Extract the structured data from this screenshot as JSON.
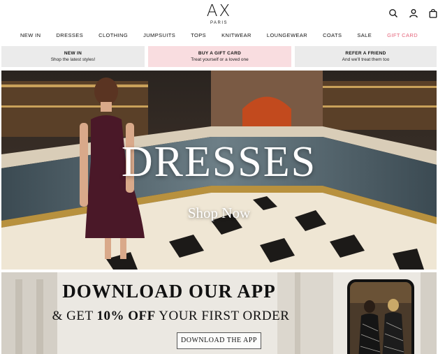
{
  "brand": {
    "name": "AX",
    "subtitle": "PARIS"
  },
  "header_icons": [
    "search-icon",
    "account-icon",
    "bag-icon"
  ],
  "nav": {
    "items": [
      "NEW IN",
      "DRESSES",
      "CLOTHING",
      "JUMPSUITS",
      "TOPS",
      "KNITWEAR",
      "LOUNGEWEAR",
      "COATS",
      "SALE"
    ],
    "gift": "GIFT CARD",
    "gift_color": "#e5647a"
  },
  "promos": [
    {
      "title": "NEW IN",
      "sub": "Shop the latest styles!",
      "bg": "#ebebeb"
    },
    {
      "title": "BUY A GIFT CARD",
      "sub": "Treat yourself or a loved one",
      "bg": "#f9dde0"
    },
    {
      "title": "REFER A FRIEND",
      "sub": "And we'll treat them too",
      "bg": "#ebebeb"
    }
  ],
  "hero": {
    "title": "DRESSES",
    "cta": "Shop Now"
  },
  "app_banner": {
    "title": "DOWNLOAD OUR APP",
    "sub_prefix": "& GET ",
    "sub_bold": "10% OFF",
    "sub_suffix": " YOUR FIRST ORDER",
    "button": "DOWNLOAD THE APP"
  }
}
